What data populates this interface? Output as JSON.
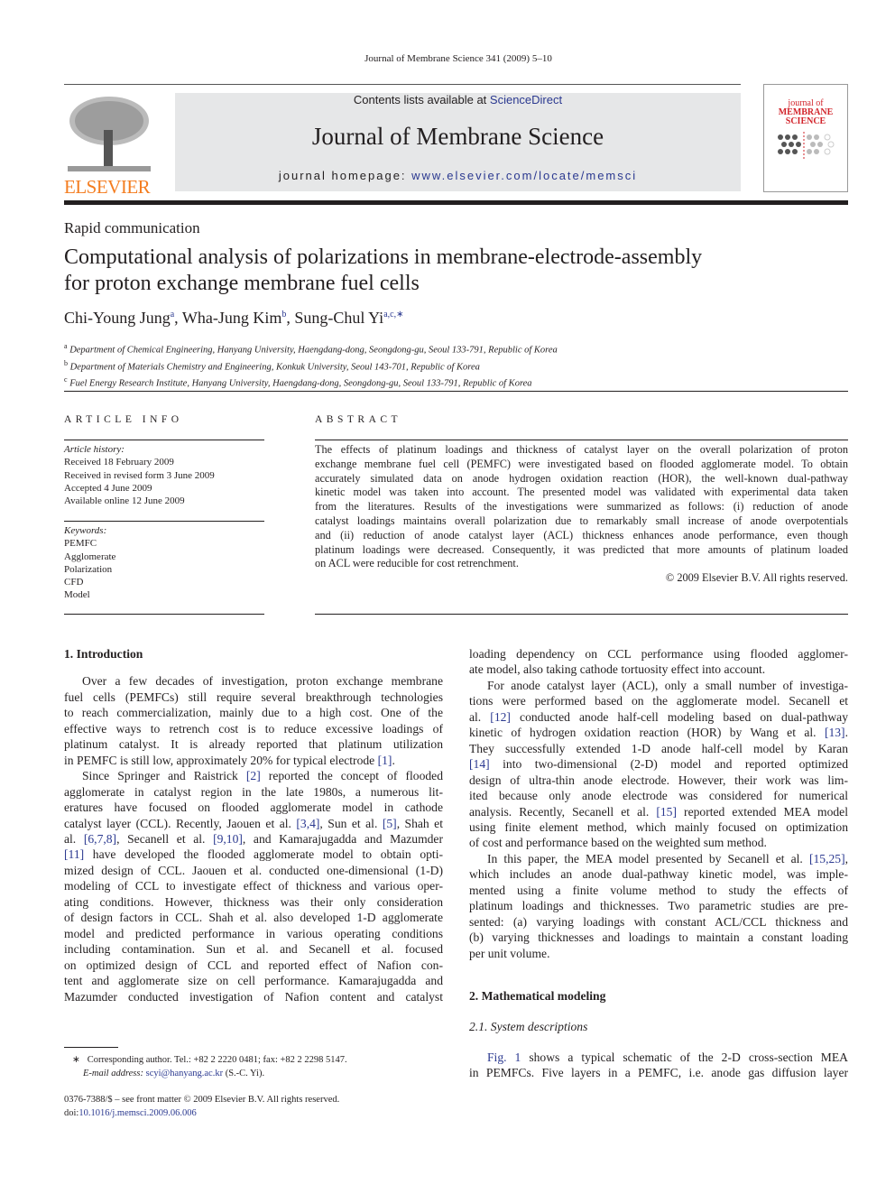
{
  "running_header": "Journal of Membrane Science 341 (2009) 5–10",
  "banner": {
    "contents_prefix": "Contents lists available at ",
    "contents_link": "ScienceDirect",
    "journal_title": "Journal of Membrane Science",
    "homepage_prefix": "journal homepage: ",
    "homepage_link": "www.elsevier.com/locate/memsci"
  },
  "publisher_logo": "ELSEVIER",
  "cover": {
    "title_lines": [
      "journal of",
      "MEMBRANE",
      "SCIENCE"
    ]
  },
  "article_type": "Rapid communication",
  "title_lines": [
    "Computational analysis of polarizations in membrane-electrode-assembly",
    "for proton exchange membrane fuel cells"
  ],
  "authors": [
    {
      "name": "Chi-Young Jung",
      "sup": "a"
    },
    {
      "name": "Wha-Jung Kim",
      "sup": "b"
    },
    {
      "name": "Sung-Chul Yi",
      "sup": "a,c,∗"
    }
  ],
  "affiliations": [
    {
      "sup": "a",
      "text": "Department of Chemical Engineering, Hanyang University, Haengdang-dong, Seongdong-gu, Seoul 133-791, Republic of Korea"
    },
    {
      "sup": "b",
      "text": "Department of Materials Chemistry and Engineering, Konkuk University, Seoul 143-701, Republic of Korea"
    },
    {
      "sup": "c",
      "text": "Fuel Energy Research Institute, Hanyang University, Haengdang-dong, Seongdong-gu, Seoul 133-791, Republic of Korea"
    }
  ],
  "article_info": {
    "heading": "ARTICLE INFO",
    "history_label": "Article history:",
    "history": [
      "Received 18 February 2009",
      "Received in revised form 3 June 2009",
      "Accepted 4 June 2009",
      "Available online 12 June 2009"
    ],
    "keywords_label": "Keywords:",
    "keywords": [
      "PEMFC",
      "Agglomerate",
      "Polarization",
      "CFD",
      "Model"
    ]
  },
  "abstract": {
    "heading": "ABSTRACT",
    "lines": [
      "The effects of platinum loadings and thickness of catalyst layer on the overall polarization of proton",
      "exchange membrane fuel cell (PEMFC) were investigated based on flooded agglomerate model. To obtain",
      "accurately simulated data on anode hydrogen oxidation reaction (HOR), the well-known dual-pathway",
      "kinetic model was taken into account. The presented model was validated with experimental data taken",
      "from the literatures. Results of the investigations were summarized as follows: (i) reduction of anode",
      "catalyst loadings maintains overall polarization due to remarkably small increase of anode overpotentials",
      "and (ii) reduction of anode catalyst layer (ACL) thickness enhances anode performance, even though",
      "platinum loadings were decreased. Consequently, it was predicted that more amounts of platinum loaded",
      "on ACL were reducible for cost retrenchment."
    ],
    "copyright": "© 2009 Elsevier B.V. All rights reserved."
  },
  "section1": {
    "heading": "1.  Introduction",
    "p1": [
      "Over a few decades of investigation, proton exchange membrane",
      "fuel cells (PEMFCs) still require several breakthrough technologies",
      "to reach commercialization, mainly due to a high cost. One of the",
      "effective ways to retrench cost is to reduce excessive loadings of",
      "platinum catalyst. It is already reported that platinum utilization",
      "in PEMFC is still low, approximately 20% for typical electrode [1]."
    ],
    "p2": [
      "Since Springer and Raistrick [2] reported the concept of flooded",
      "agglomerate in catalyst region in the late 1980s, a numerous lit-",
      "eratures have focused on flooded agglomerate model in cathode",
      "catalyst layer (CCL). Recently, Jaouen et al. [3,4], Sun et al. [5], Shah et",
      "al. [6,7,8], Secanell et al. [9,10], and Kamarajugadda and Mazumder",
      "[11] have developed the flooded agglomerate model to obtain opti-",
      "mized design of CCL. Jaouen et al. conducted one-dimensional (1-D)",
      "modeling of CCL to investigate effect of thickness and various oper-",
      "ating conditions. However, thickness was their only consideration",
      "of design factors in CCL. Shah et al. also developed 1-D agglomerate",
      "model and predicted performance in various operating conditions",
      "including contamination. Sun et al. and Secanell et al. focused",
      "on optimized design of CCL and reported effect of Nafion con-",
      "tent and agglomerate size on cell performance. Kamarajugadda and",
      "Mazumder conducted investigation of Nafion content and catalyst"
    ],
    "p2_cont": [
      "loading dependency on CCL performance using flooded agglomer-",
      "ate model, also taking cathode tortuosity effect into account."
    ],
    "p3": [
      "For anode catalyst layer (ACL), only a small number of investiga-",
      "tions were performed based on the agglomerate model. Secanell et",
      "al. [12] conducted anode half-cell modeling based on dual-pathway",
      "kinetic of hydrogen oxidation reaction (HOR) by Wang et al. [13].",
      "They successfully extended 1-D anode half-cell model by Karan",
      "[14] into two-dimensional (2-D) model and reported optimized",
      "design of ultra-thin anode electrode. However, their work was lim-",
      "ited because only anode electrode was considered for numerical",
      "analysis. Recently, Secanell et al. [15] reported extended MEA model",
      "using finite element method, which mainly focused on optimization",
      "of cost and performance based on the weighted sum method."
    ],
    "p4": [
      "In this paper, the MEA model presented by Secanell et al. [15,25],",
      "which includes an anode dual-pathway kinetic model, was imple-",
      "mented using a finite volume method to study the effects of",
      "platinum loadings and thicknesses. Two parametric studies are pre-",
      "sented: (a) varying loadings with constant ACL/CCL thickness and",
      "(b) varying thicknesses and loadings to maintain a constant loading",
      "per unit volume."
    ]
  },
  "section2": {
    "heading": "2.  Mathematical modeling",
    "sub_heading": "2.1.  System descriptions",
    "p1": [
      "Fig. 1 shows a typical schematic of the 2-D cross-section MEA",
      "in PEMFCs. Five layers in a PEMFC, i.e. anode gas diffusion layer"
    ]
  },
  "footnote": {
    "star": "∗",
    "corresponding": "Corresponding author. Tel.: +82 2 2220 0481; fax: +82 2 2298 5147.",
    "email_label": "E-mail address:",
    "email": "scyi@hanyang.ac.kr",
    "email_suffix": " (S.-C. Yi)."
  },
  "front_matter": "0376-7388/$ – see front matter © 2009 Elsevier B.V. All rights reserved.",
  "doi_label": "doi:",
  "doi": "10.1016/j.memsci.2009.06.006",
  "colors": {
    "link": "#2b3990",
    "elsevier": "#f47d20",
    "cover_title": "#d2232a",
    "banner_bg": "#e6e7e8"
  }
}
